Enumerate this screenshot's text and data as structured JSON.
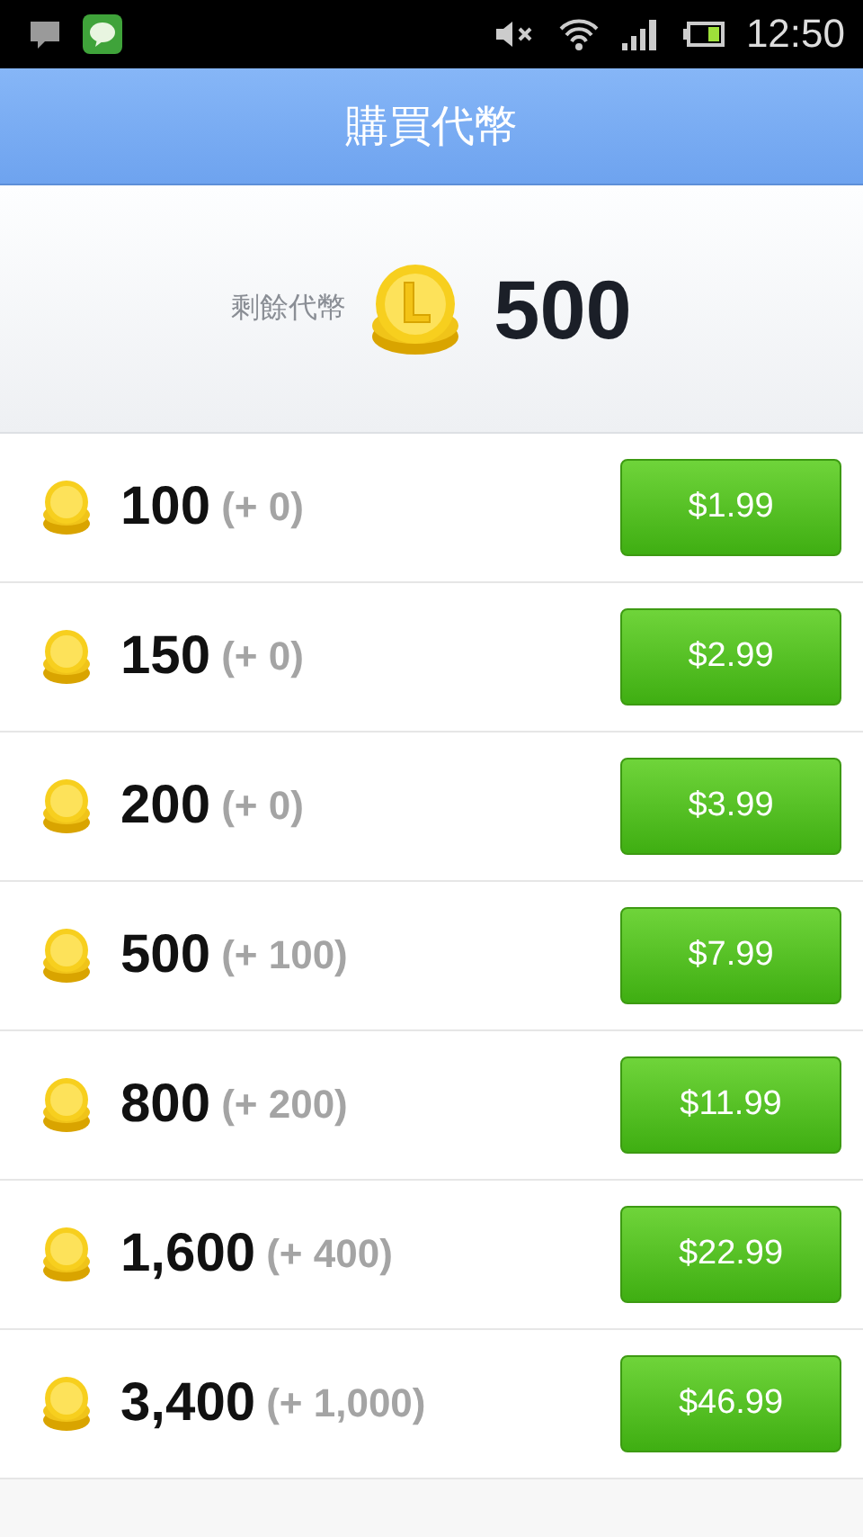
{
  "status_bar": {
    "time": "12:50"
  },
  "header": {
    "title": "購買代幣"
  },
  "balance": {
    "label": "剩餘代幣",
    "amount": "500"
  },
  "packages": [
    {
      "coins": "100",
      "bonus": "(+ 0)",
      "price": "$1.99"
    },
    {
      "coins": "150",
      "bonus": "(+ 0)",
      "price": "$2.99"
    },
    {
      "coins": "200",
      "bonus": "(+ 0)",
      "price": "$3.99"
    },
    {
      "coins": "500",
      "bonus": "(+ 100)",
      "price": "$7.99"
    },
    {
      "coins": "800",
      "bonus": "(+ 200)",
      "price": "$11.99"
    },
    {
      "coins": "1,600",
      "bonus": "(+ 400)",
      "price": "$22.99"
    },
    {
      "coins": "3,400",
      "bonus": "(+ 1,000)",
      "price": "$46.99"
    }
  ]
}
